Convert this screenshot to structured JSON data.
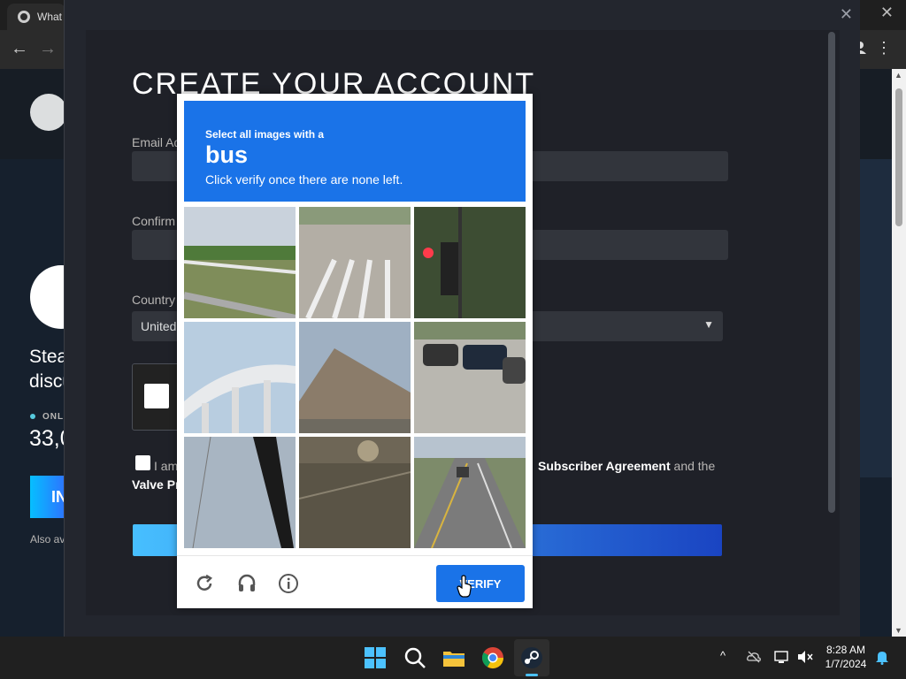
{
  "browser": {
    "tab_title": "What",
    "close_glyph": "✕",
    "back_glyph": "←",
    "forward_glyph": "→",
    "menu_glyph": "⋮"
  },
  "steam_page": {
    "left_heading_1": "Stea",
    "left_heading_2": "discu",
    "online_label": "ONLI",
    "online_count": "33,0",
    "install_label": "IN",
    "also_available": "Also av"
  },
  "modal": {
    "close_glyph": "✕",
    "title": "CREATE YOUR ACCOUNT",
    "email_label": "Email Ad",
    "confirm_label": "Confirm",
    "country_label": "Country",
    "country_value": "United",
    "agree_prefix": "I am",
    "agree_link": "Subscriber Agreement",
    "agree_suffix": " and the",
    "privacy_prefix": "Valve Pr"
  },
  "captcha": {
    "prompt_line1": "Select all images with a",
    "prompt_target": "bus",
    "prompt_line3": "Click verify once there are none left.",
    "tiles": [
      {
        "name": "tile-grass-guardrail"
      },
      {
        "name": "tile-crosswalk"
      },
      {
        "name": "tile-traffic-light"
      },
      {
        "name": "tile-overpass"
      },
      {
        "name": "tile-roof"
      },
      {
        "name": "tile-parking-lot"
      },
      {
        "name": "tile-pole"
      },
      {
        "name": "tile-sunset-road"
      },
      {
        "name": "tile-road-car"
      }
    ],
    "verify_label": "VERIFY"
  },
  "taskbar": {
    "time": "8:28 AM",
    "date": "1/7/2024",
    "tray_chevron": "^"
  },
  "colors": {
    "captcha_blue": "#1a73e8",
    "steam_dark": "#1b2838",
    "taskbar": "#202020"
  }
}
